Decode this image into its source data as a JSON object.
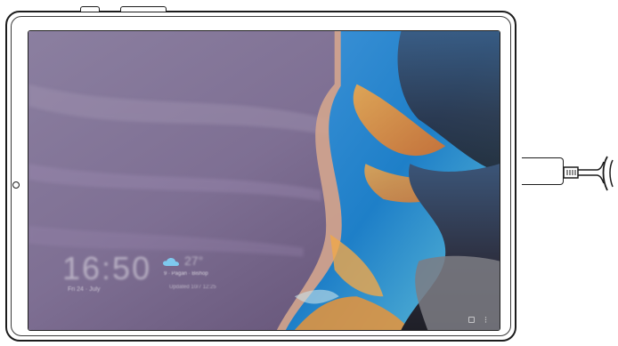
{
  "lock_screen": {
    "clock": "16:50",
    "date": "Fri 24 · July",
    "temperature": "27°",
    "location": "9 · Pagan · Bishop",
    "updated": "Updated 10/7 12:25"
  },
  "colors": {
    "device_outline": "#1c1c1c",
    "wallpaper_purple": "#7a6f8e",
    "wallpaper_blue": "#2f8ad2",
    "wallpaper_orange": "#e8943a"
  },
  "icons": {
    "weather": "cloud-icon",
    "camera": "front-camera-icon",
    "cable": "usb-c-cable-icon"
  }
}
